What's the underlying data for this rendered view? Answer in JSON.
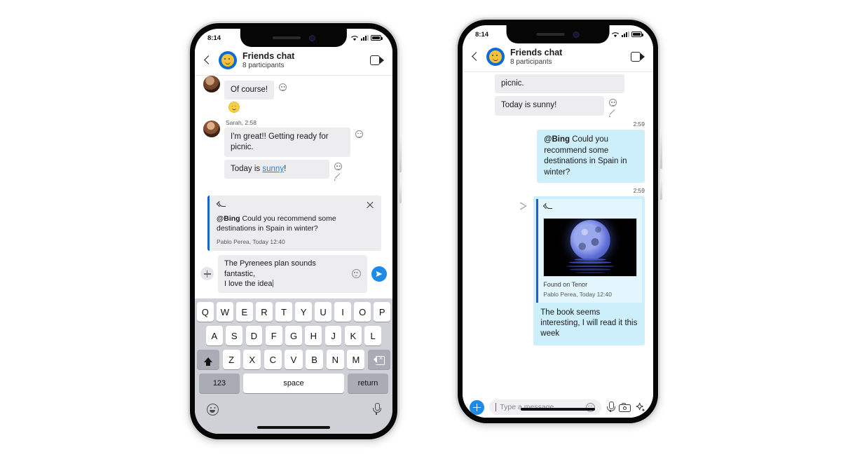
{
  "left_phone": {
    "status": {
      "time": "8:14",
      "wifi": "wifi-icon",
      "signal": "signal-icon",
      "battery": "battery-icon"
    },
    "header": {
      "back": "back-chevron-icon",
      "avatar": "group-avatar-smiley",
      "title": "Friends chat",
      "subtitle": "8 participants",
      "video_call": "video-call-icon"
    },
    "messages": [
      {
        "author": "",
        "text": "Of course!",
        "reaction": "🙂"
      },
      {
        "author": "Sarah, 2:58",
        "text": "I'm great!! Getting ready for picnic."
      },
      {
        "text_pre": "Today is ",
        "link": "sunny",
        "text_post": "!"
      }
    ],
    "reply_card": {
      "reply_icon": "reply-arrow-icon",
      "close_icon": "close-icon",
      "mention": "@Bing",
      "body": " Could you recommend some destinations in Spain in winter?",
      "author": "Pablo Perea, Today 12:40"
    },
    "composer": {
      "plus": "add-attachment-icon",
      "draft_line1": "The Pyrenees plan sounds fantastic,",
      "draft_line2": "I love the idea",
      "emoji": "emoji-icon",
      "send": "send-icon"
    },
    "keyboard": {
      "row1": [
        "Q",
        "W",
        "E",
        "R",
        "T",
        "Y",
        "U",
        "I",
        "O",
        "P"
      ],
      "row2": [
        "A",
        "S",
        "D",
        "F",
        "G",
        "H",
        "J",
        "K",
        "L"
      ],
      "row3": [
        "Z",
        "X",
        "C",
        "V",
        "B",
        "N",
        "M"
      ],
      "shift": "shift-icon",
      "delete": "backspace-icon",
      "numbers": "123",
      "space": "space",
      "return": "return",
      "emoji_key": "keyboard-emoji-icon",
      "dictation": "microphone-icon"
    }
  },
  "right_phone": {
    "status": {
      "time": "8:14",
      "wifi": "wifi-icon",
      "signal": "signal-icon",
      "battery": "battery-icon"
    },
    "header": {
      "back": "back-chevron-icon",
      "avatar": "group-avatar-smiley",
      "title": "Friends chat",
      "subtitle": "8 participants",
      "video_call": "video-call-icon"
    },
    "messages": [
      {
        "text": "picnic."
      },
      {
        "text": "Today is sunny!"
      }
    ],
    "timestamps": {
      "first": "2:59",
      "second": "2:59"
    },
    "outgoing_bubble": {
      "mention": "@Bing",
      "body": " Could you recommend some destinations in Spain in winter?"
    },
    "outgoing_card": {
      "sent_icon": "sent-arrow-icon",
      "reply_icon": "reply-arrow-icon",
      "media": "moon-gif",
      "caption": "Found on Tenor",
      "author": "Pablo Perea, Today 12:40",
      "message": "The book seems interesting, I will read it this week"
    },
    "composer": {
      "plus": "add-attachment-icon",
      "placeholder": "Type a message",
      "emoji": "emoji-icon",
      "mic": "microphone-icon",
      "camera": "camera-icon",
      "sparkle": "ai-sparkle-icon"
    }
  },
  "colors": {
    "accent_blue": "#1d8ae8",
    "quote_border": "#1b62d0",
    "outgoing_bubble": "#cdeefb",
    "incoming_bubble": "#ededef",
    "link": "#2f7fd4",
    "keyboard_bg": "#cfd1d6"
  }
}
